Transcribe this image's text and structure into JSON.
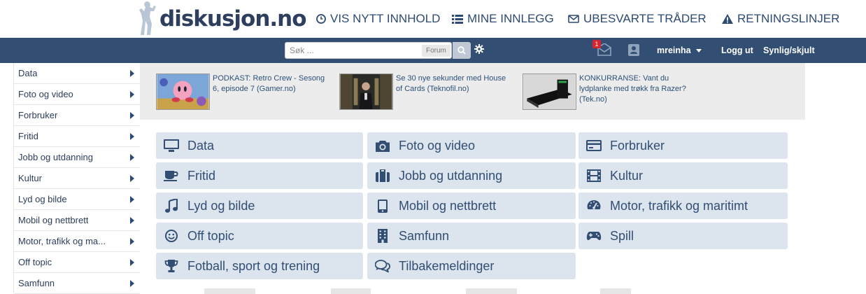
{
  "header": {
    "logo_text": "diskusjon.no",
    "nav": [
      {
        "label": "VIS NYTT INNHOLD",
        "icon": "clock-icon"
      },
      {
        "label": "MINE INNLEGG",
        "icon": "list-icon"
      },
      {
        "label": "UBESVARTE TRÅDER",
        "icon": "envelope-icon"
      },
      {
        "label": "RETNINGSLINJER",
        "icon": "warning-icon"
      }
    ]
  },
  "navbar": {
    "search_placeholder": "Søk ...",
    "search_scope": "Forum",
    "messages_count": "1",
    "username": "mreinha",
    "logout": "Logg ut",
    "visibility": "Synlig/skjult"
  },
  "sidebar": {
    "items": [
      {
        "label": "Data"
      },
      {
        "label": "Foto og video"
      },
      {
        "label": "Forbruker"
      },
      {
        "label": "Fritid"
      },
      {
        "label": "Jobb og utdanning"
      },
      {
        "label": "Kultur"
      },
      {
        "label": "Lyd og bilde"
      },
      {
        "label": "Mobil og nettbrett"
      },
      {
        "label": "Motor, trafikk og ma..."
      },
      {
        "label": "Off topic"
      },
      {
        "label": "Samfunn"
      }
    ]
  },
  "news": [
    {
      "text": "PODKAST: Retro Crew - Sesong 6, episode 7 (Gamer.no)"
    },
    {
      "text": "Se 30 nye sekunder med House of Cards (Teknofil.no)"
    },
    {
      "text": "KONKURRANSE: Vant du lydplanke med trøkk fra Razer? (Tek.no)"
    }
  ],
  "categories": [
    {
      "label": "Data",
      "icon": "monitor-icon"
    },
    {
      "label": "Foto og video",
      "icon": "camera-icon"
    },
    {
      "label": "Forbruker",
      "icon": "credit-card-icon"
    },
    {
      "label": "Fritid",
      "icon": "coffee-cup-icon"
    },
    {
      "label": "Jobb og utdanning",
      "icon": "briefcase-icon"
    },
    {
      "label": "Kultur",
      "icon": "film-icon"
    },
    {
      "label": "Lyd og bilde",
      "icon": "music-note-icon"
    },
    {
      "label": "Mobil og nettbrett",
      "icon": "tablet-icon"
    },
    {
      "label": "Motor, trafikk og maritimt",
      "icon": "dashboard-icon"
    },
    {
      "label": "Off topic",
      "icon": "smiley-icon"
    },
    {
      "label": "Samfunn",
      "icon": "building-icon"
    },
    {
      "label": "Spill",
      "icon": "gamepad-icon"
    },
    {
      "label": "Fotball, sport og trening",
      "icon": "trophy-icon"
    },
    {
      "label": "Tilbakemeldinger",
      "icon": "comments-icon"
    }
  ],
  "colors": {
    "navbar": "#324e73",
    "category_tile": "#dce4ee",
    "text_dark": "#324e73",
    "badge": "#d9232e"
  }
}
